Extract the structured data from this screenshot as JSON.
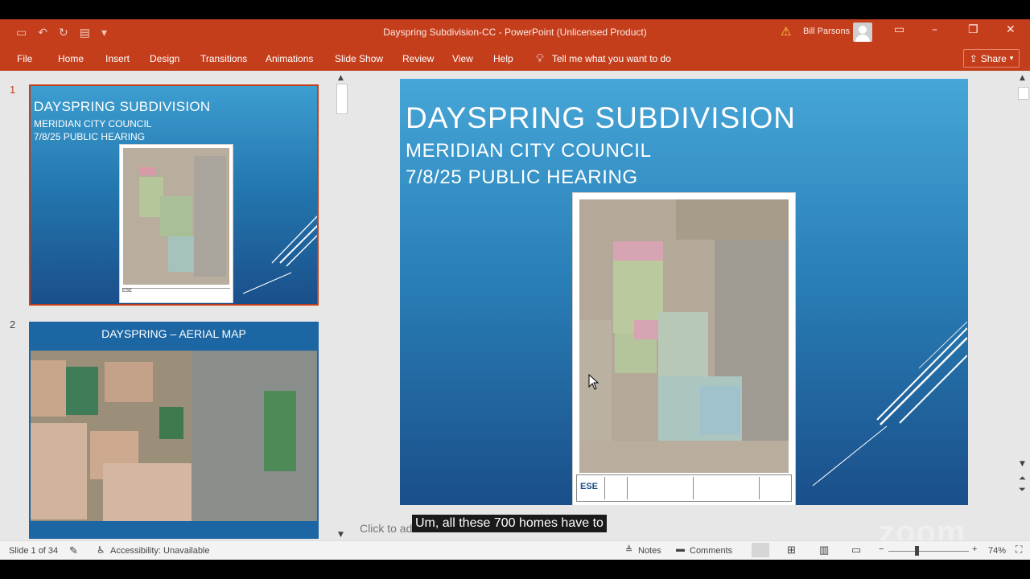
{
  "window": {
    "title": "Dayspring Subdivision-CC  -  PowerPoint (Unlicensed Product)",
    "user": "Bill Parsons",
    "warning_icon": "warning-icon"
  },
  "ribbon": {
    "tabs": [
      "File",
      "Home",
      "Insert",
      "Design",
      "Transitions",
      "Animations",
      "Slide Show",
      "Review",
      "View",
      "Help"
    ],
    "tell_me": "Tell me what you want to do",
    "share": "Share"
  },
  "thumbnails": [
    {
      "number": "1",
      "title": "DAYSPRING SUBDIVISION",
      "line1": "MERIDIAN CITY COUNCIL",
      "line2": "7/8/25 PUBLIC HEARING"
    },
    {
      "number": "2",
      "title": "DAYSPRING – AERIAL MAP"
    }
  ],
  "slide": {
    "title": "DAYSPRING SUBDIVISION",
    "line1": "MERIDIAN CITY COUNCIL",
    "line2": "7/8/25 PUBLIC HEARING",
    "plan_logo": "ESE"
  },
  "notes_placeholder": "Click to add notes",
  "caption": "Um, all these 700 homes have to",
  "watermark": "zoom",
  "status": {
    "slide_count": "Slide 1 of 34",
    "accessibility": "Accessibility: Unavailable",
    "notes": "Notes",
    "comments": "Comments",
    "zoom": "74%"
  }
}
